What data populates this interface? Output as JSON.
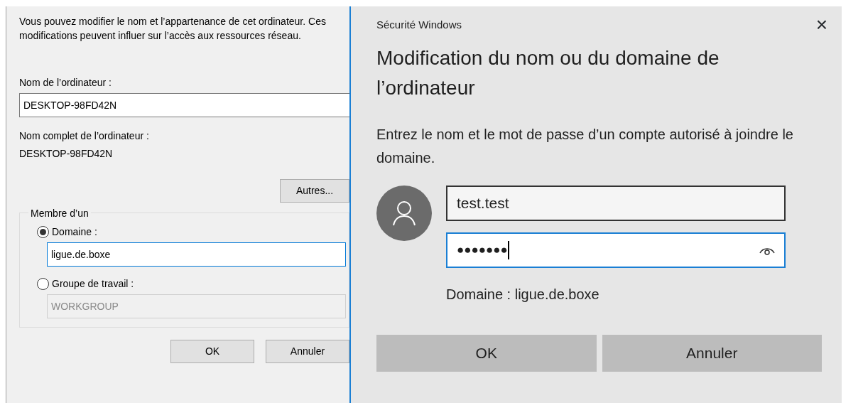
{
  "back_dialog": {
    "description": "Vous pouvez modifier le nom et l’appartenance de cet ordinateur. Ces modifications peuvent influer sur l’accès aux ressources réseau.",
    "computer_name": {
      "label": "Nom de l’ordinateur :",
      "value": "DESKTOP-98FD42N"
    },
    "full_name": {
      "label": "Nom complet de l’ordinateur :",
      "value": "DESKTOP-98FD42N"
    },
    "more_button": "Autres...",
    "member_of": {
      "legend": "Membre d’un",
      "options": [
        {
          "label": "Domaine :",
          "selected": true,
          "value": "ligue.de.boxe",
          "disabled": false
        },
        {
          "label": "Groupe de travail :",
          "selected": false,
          "value": "WORKGROUP",
          "disabled": true
        }
      ]
    },
    "buttons": [
      "OK",
      "Annuler"
    ]
  },
  "security_dialog": {
    "window_title": "Sécurité Windows",
    "close": "×",
    "heading": "Modification du nom ou du domaine de l’ordinateur",
    "prompt": "Entrez le nom et le mot de passe d’un compte autorisé à joindre le domaine.",
    "username": {
      "value": "test.test"
    },
    "password": {
      "value": "●●●●●●●",
      "focused": true
    },
    "domain_note": "Domaine : ligue.de.boxe",
    "buttons": [
      "OK",
      "Annuler"
    ]
  }
}
